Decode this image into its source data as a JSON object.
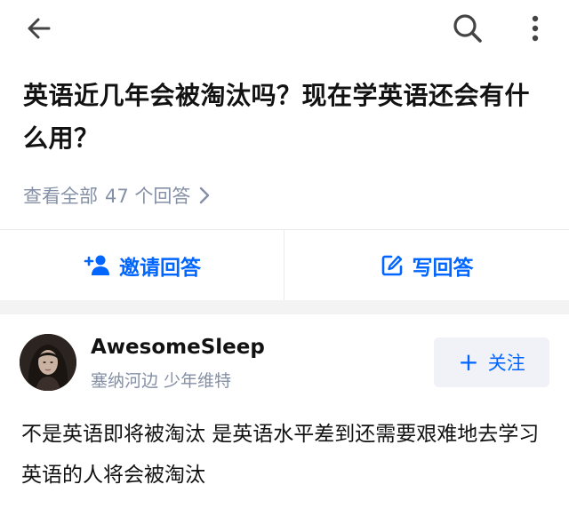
{
  "topbar": {
    "back_icon": "arrow-left-icon",
    "search_icon": "search-icon",
    "more_icon": "more-vertical-icon"
  },
  "question": {
    "title": "英语近几年会被淘汰吗？现在学英语还会有什么用？",
    "view_all_prefix": "查看全部",
    "view_all_count": "47 个回答",
    "chevron_icon": "chevron-right-icon"
  },
  "actions": {
    "invite_label": "邀请回答",
    "invite_icon": "add-user-icon",
    "write_label": "写回答",
    "write_icon": "edit-icon"
  },
  "answer": {
    "author_name": "AwesomeSleep",
    "author_bio": "塞纳河边 少年维特",
    "follow_label": "关注",
    "follow_plus": "+",
    "text": "不是英语即将被淘汰 是英语水平差到还需要艰难地去学习英语的人将会被淘汰"
  },
  "colors": {
    "accent": "#0066ff",
    "secondary_text": "#8590a6",
    "primary_text": "#121212",
    "separator": "#f3f3f3"
  }
}
